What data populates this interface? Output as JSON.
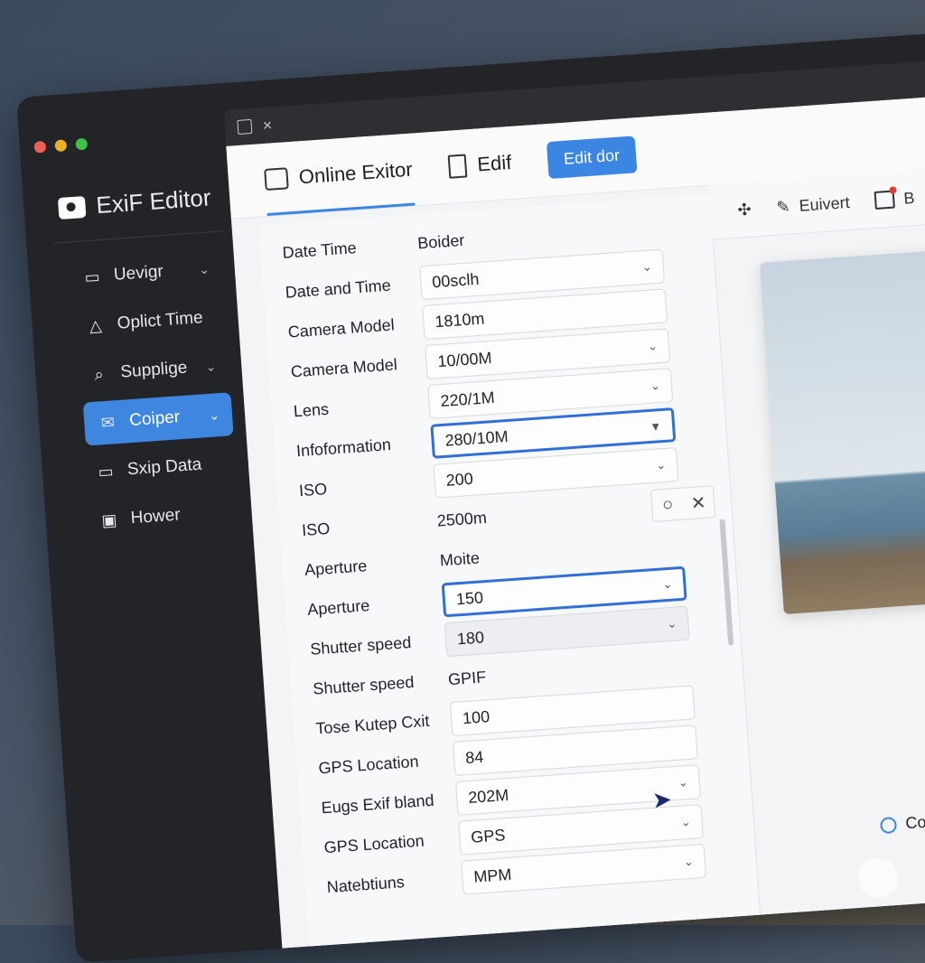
{
  "app": {
    "title": "ExiF Editor",
    "titlebar_close": "×"
  },
  "sidebar": {
    "items": [
      {
        "label": "Uevigr",
        "icon": "folder-icon",
        "chevron": true,
        "active": false
      },
      {
        "label": "Oplict Time",
        "icon": "warning-icon",
        "chevron": false,
        "active": false
      },
      {
        "label": "Supplige",
        "icon": "search-icon",
        "chevron": true,
        "active": false
      },
      {
        "label": "Coiper",
        "icon": "mail-icon",
        "chevron": true,
        "active": true
      },
      {
        "label": "Sxip Data",
        "icon": "folder-icon",
        "chevron": false,
        "active": false
      },
      {
        "label": "Hower",
        "icon": "file-icon",
        "chevron": false,
        "active": false
      }
    ]
  },
  "header": {
    "tabs": [
      {
        "label": "Online Exitor",
        "icon": "camera-icon",
        "selected": true
      },
      {
        "label": "Edif",
        "icon": "document-icon",
        "selected": false
      }
    ],
    "primary_button": "Edit dor"
  },
  "form": {
    "rows": [
      {
        "label": "Date Time",
        "text": "Boider"
      },
      {
        "label": "Date and Time",
        "field": "00sclh",
        "dropdown": true
      },
      {
        "label": "Camera Model",
        "field": "1810m",
        "dropdown": false
      },
      {
        "label": "Camera Model",
        "field": "10/00M",
        "dropdown": true
      },
      {
        "label": "Lens",
        "field": "220/1M",
        "dropdown": true
      },
      {
        "label": "Infoformation",
        "field": "280/10M",
        "dropdown": true,
        "highlight": true
      },
      {
        "label": "ISO",
        "field": "200",
        "dropdown": true
      },
      {
        "label": "ISO",
        "text": "2500m",
        "icon_buttons": [
          "circle-icon",
          "close-icon"
        ]
      },
      {
        "label": "Aperture",
        "text": "Moite"
      },
      {
        "label": "Aperture",
        "field": "150",
        "dropdown": true,
        "highlight": true
      },
      {
        "label": "Shutter speed",
        "field": "180",
        "dropdown": true,
        "shaded": true
      },
      {
        "label": "Shutter speed",
        "text": "GPIF"
      },
      {
        "label": "Tose Kutep Cxit",
        "field": "100",
        "dropdown": false
      },
      {
        "label": "GPS Location",
        "field": "84",
        "dropdown": false
      },
      {
        "label": "Eugs Exif bland",
        "field": "202M",
        "dropdown": true
      },
      {
        "label": "GPS Location",
        "field": "GPS",
        "dropdown": true
      },
      {
        "label": "Natebtiuns",
        "field": "MPM",
        "dropdown": true
      }
    ]
  },
  "right_toolbar": {
    "items": [
      {
        "label": "",
        "icon": "sparkle-icon"
      },
      {
        "label": "Euivert",
        "icon": "edit-icon"
      },
      {
        "label": "B",
        "icon": "notification-icon"
      }
    ]
  },
  "bottom_label": "Codere",
  "watermark": "ai",
  "colors": {
    "accent": "#3a86e2",
    "highlight_border": "#2f6fd6",
    "sidebar_bg": "#222427"
  }
}
